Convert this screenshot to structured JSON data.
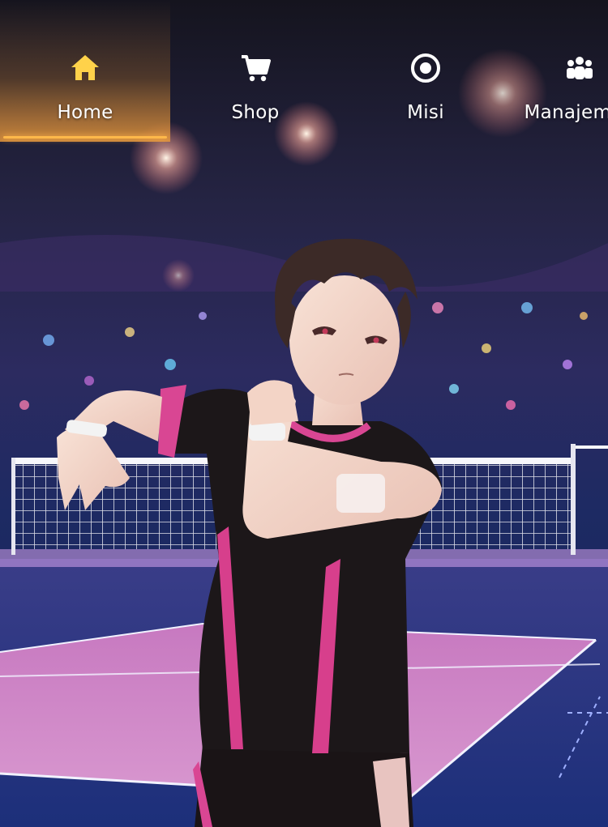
{
  "nav": {
    "items": [
      {
        "label": "Home",
        "icon": "home-icon",
        "active": true
      },
      {
        "label": "Shop",
        "icon": "cart-icon",
        "active": false
      },
      {
        "label": "Misi",
        "icon": "target-icon",
        "active": false
      },
      {
        "label": "Manajemen",
        "icon": "team-icon",
        "active": false
      }
    ]
  },
  "colors": {
    "active_accent": "#ffb84a",
    "active_icon": "#ffd24a",
    "court": "#d58ac8",
    "jersey_trim": "#e0408e"
  }
}
